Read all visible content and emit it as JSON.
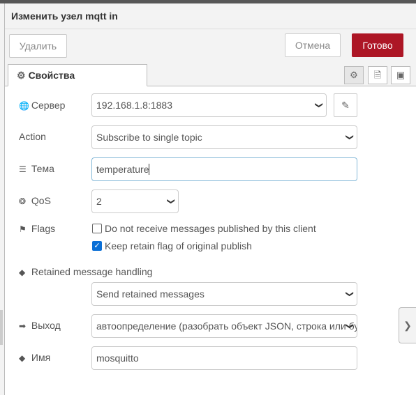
{
  "header": {
    "title": "Изменить узел mqtt in"
  },
  "toolbar": {
    "delete_label": "Удалить",
    "cancel_label": "Отмена",
    "done_label": "Готово"
  },
  "tabs": {
    "properties_label": "Свойства",
    "gear_icon": "gear-icon",
    "doc_icon": "document-icon",
    "layout_icon": "layout-icon"
  },
  "form": {
    "server": {
      "label": "Сервер",
      "icon": "globe-icon",
      "value": "192.168.1.8:1883"
    },
    "action": {
      "label": "Action",
      "value": "Subscribe to single topic"
    },
    "topic": {
      "label": "Тема",
      "icon": "tasks-icon",
      "value": "temperature"
    },
    "qos": {
      "label": "QoS",
      "icon": "life-ring-icon",
      "value": "2"
    },
    "flags": {
      "label": "Flags",
      "icon": "flag-icon",
      "no_local": {
        "label": "Do not receive messages published by this client",
        "checked": false
      },
      "rap": {
        "label": "Keep retain flag of original publish",
        "checked": true
      }
    },
    "retain_handling": {
      "label": "Retained message handling",
      "icon": "tag-icon",
      "value": "Send retained messages"
    },
    "output": {
      "label": "Выход",
      "icon": "sign-out-icon",
      "value": "автоопределение (разобрать объект JSON, строка или буфер)"
    },
    "name": {
      "label": "Имя",
      "icon": "tag-icon",
      "value": "mosquitto"
    }
  },
  "colors": {
    "primary": "#ad1625",
    "checkbox": "#0a6fd6",
    "focus_border": "#85b9d8"
  }
}
